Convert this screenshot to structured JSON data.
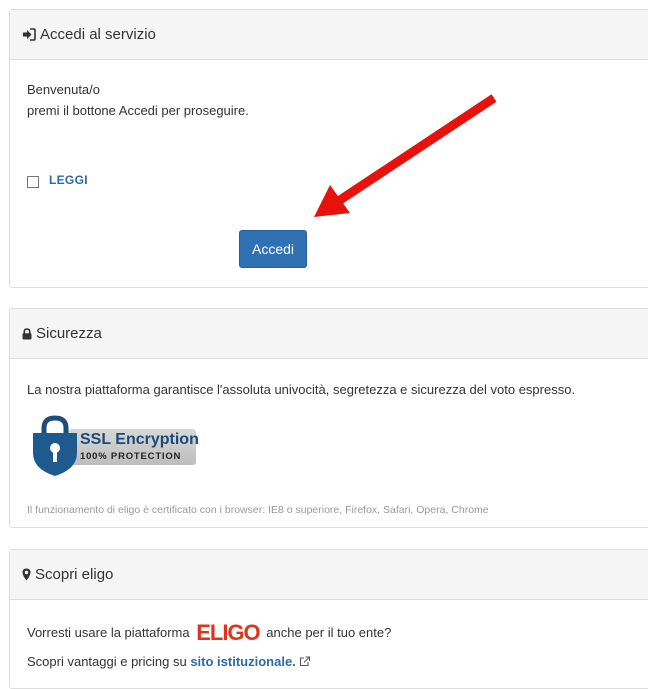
{
  "access_panel": {
    "title": "Accedi al servizio",
    "welcome": "Benvenuta/o",
    "instruction": "premi il bottone Accedi per proseguire.",
    "checkbox_label": "LEGGI",
    "button_label": "Accedi",
    "icon": "sign-in-icon",
    "arrow_color": "#e8120c"
  },
  "security_panel": {
    "title": "Sicurezza",
    "icon": "lock-icon",
    "description": "La nostra piattaforma garantisce l'assoluta univocità, segretezza e sicurezza del voto espresso.",
    "badge_title": "SSL Encryption",
    "badge_subtitle": "100% PROTECTION",
    "browser_note": "Il funzionamento di eligo è certificato con i browser: IE8 o superiore, Firefox, Safari, Opera, Chrome"
  },
  "discover_panel": {
    "title": "Scopri eligo",
    "icon": "map-marker-icon",
    "line1_prefix": "Vorresti usare la piattaforma",
    "brand": "ELIGO",
    "line1_suffix": "anche per il tuo ente?",
    "line2_prefix": "Scopri vantaggi e pricing su",
    "link_text": "sito istituzionale.",
    "link_icon": "external-link-icon",
    "brand_color": "#e0341c"
  }
}
